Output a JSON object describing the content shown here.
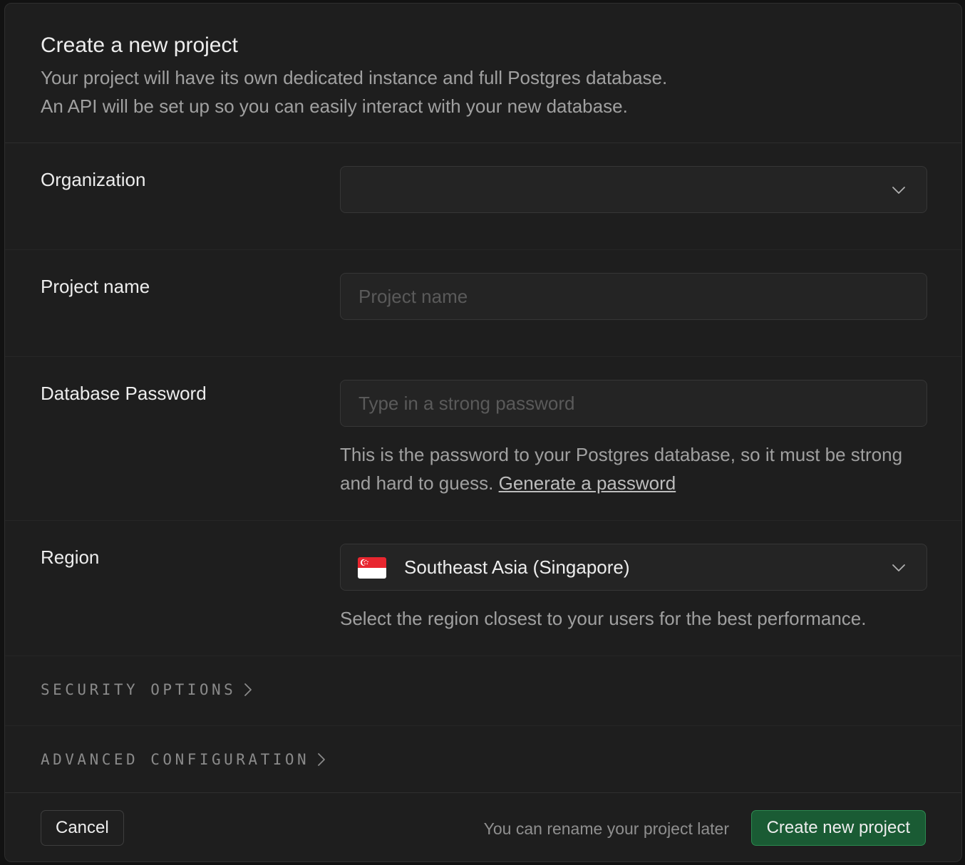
{
  "dialog": {
    "title": "Create a new project",
    "subtitle_line1": "Your project will have its own dedicated instance and full Postgres database.",
    "subtitle_line2": "An API will be set up so you can easily interact with your new database."
  },
  "organization": {
    "label": "Organization",
    "value": ""
  },
  "project_name": {
    "label": "Project name",
    "placeholder": "Project name",
    "value": ""
  },
  "password": {
    "label": "Database Password",
    "placeholder": "Type in a strong password",
    "help": "This is the password to your Postgres database, so it must be strong and hard to guess.",
    "generate_link": "Generate a password"
  },
  "region": {
    "label": "Region",
    "value": "Southeast Asia (Singapore)",
    "flag_icon": "singapore-flag",
    "help": "Select the region closest to your users for the best performance."
  },
  "sections": {
    "security": "SECURITY OPTIONS",
    "advanced": "ADVANCED CONFIGURATION"
  },
  "footer": {
    "cancel_label": "Cancel",
    "note": "You can rename your project later",
    "create_label": "Create new project"
  },
  "colors": {
    "background": "#1e1e1e",
    "primary_button": "#1a5b34",
    "primary_border": "#2c8a50",
    "flag_red": "#e8262f"
  }
}
